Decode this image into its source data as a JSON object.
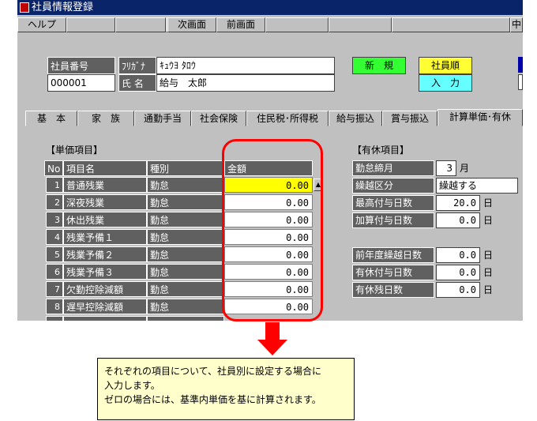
{
  "window": {
    "title": "社員情報登録"
  },
  "fkeys": [
    "ヘルプ",
    "",
    "",
    "",
    "次画面",
    "前画面",
    "",
    "",
    "",
    "中"
  ],
  "employee": {
    "number_label": "社員番号",
    "number_value": "000001",
    "furigana_label": "ﾌﾘｶﾞﾅ",
    "furigana_value": "ｷｭｳﾖ ﾀﾛｳ",
    "name_label": "氏 名",
    "name_value": "給与　太郎"
  },
  "badges": {
    "new": "新　規",
    "order": "社員順",
    "input": "入　力"
  },
  "tabs": [
    "基　本",
    "家　族",
    "通勤手当",
    "社会保険",
    "住民税･所得税",
    "給与振込",
    "賞与振込",
    "計算単価･有休"
  ],
  "active_tab": 7,
  "unit_section": {
    "title": "【単価項目】",
    "headers": {
      "no": "No",
      "item": "項目名",
      "type": "種別",
      "amount": "金額"
    },
    "rows": [
      {
        "no": "1",
        "item": "普通残業",
        "type": "勤怠",
        "amount": "0.00"
      },
      {
        "no": "2",
        "item": "深夜残業",
        "type": "勤怠",
        "amount": "0.00"
      },
      {
        "no": "3",
        "item": "休出残業",
        "type": "勤怠",
        "amount": "0.00"
      },
      {
        "no": "4",
        "item": "残業予備１",
        "type": "勤怠",
        "amount": "0.00"
      },
      {
        "no": "5",
        "item": "残業予備２",
        "type": "勤怠",
        "amount": "0.00"
      },
      {
        "no": "6",
        "item": "残業予備３",
        "type": "勤怠",
        "amount": "0.00"
      },
      {
        "no": "7",
        "item": "欠勤控除減額",
        "type": "勤怠",
        "amount": "0.00"
      },
      {
        "no": "8",
        "item": "遅早控除減額",
        "type": "勤怠",
        "amount": "0.00"
      }
    ]
  },
  "leave_section": {
    "title": "【有休項目】",
    "close_month_label": "勤怠締月",
    "close_month_value": "3",
    "close_month_unit": "月",
    "carry_label": "繰越区分",
    "carry_value": "繰越する",
    "max_label": "最高付与日数",
    "max_value": "20.0",
    "add_label": "加算付与日数",
    "add_value": "0.0",
    "prev_label": "前年度繰越日数",
    "prev_value": "0.0",
    "grant_label": "有休付与日数",
    "grant_value": "0.0",
    "remain_label": "有休残日数",
    "remain_value": "0.0",
    "day_unit": "日"
  },
  "note": {
    "line1": "それぞれの項目について、社員別に設定する場合に",
    "line2": "入力します。",
    "line3": "ゼロの場合には、基準内単価を基に計算されます。"
  },
  "colors": {
    "title_bar": "#0a246a",
    "badge_green": "#33ff33",
    "badge_yellow": "#ffff33",
    "badge_cyan": "#66ffff",
    "highlight": "#ff0000",
    "note_bg": "#ffffcc"
  }
}
